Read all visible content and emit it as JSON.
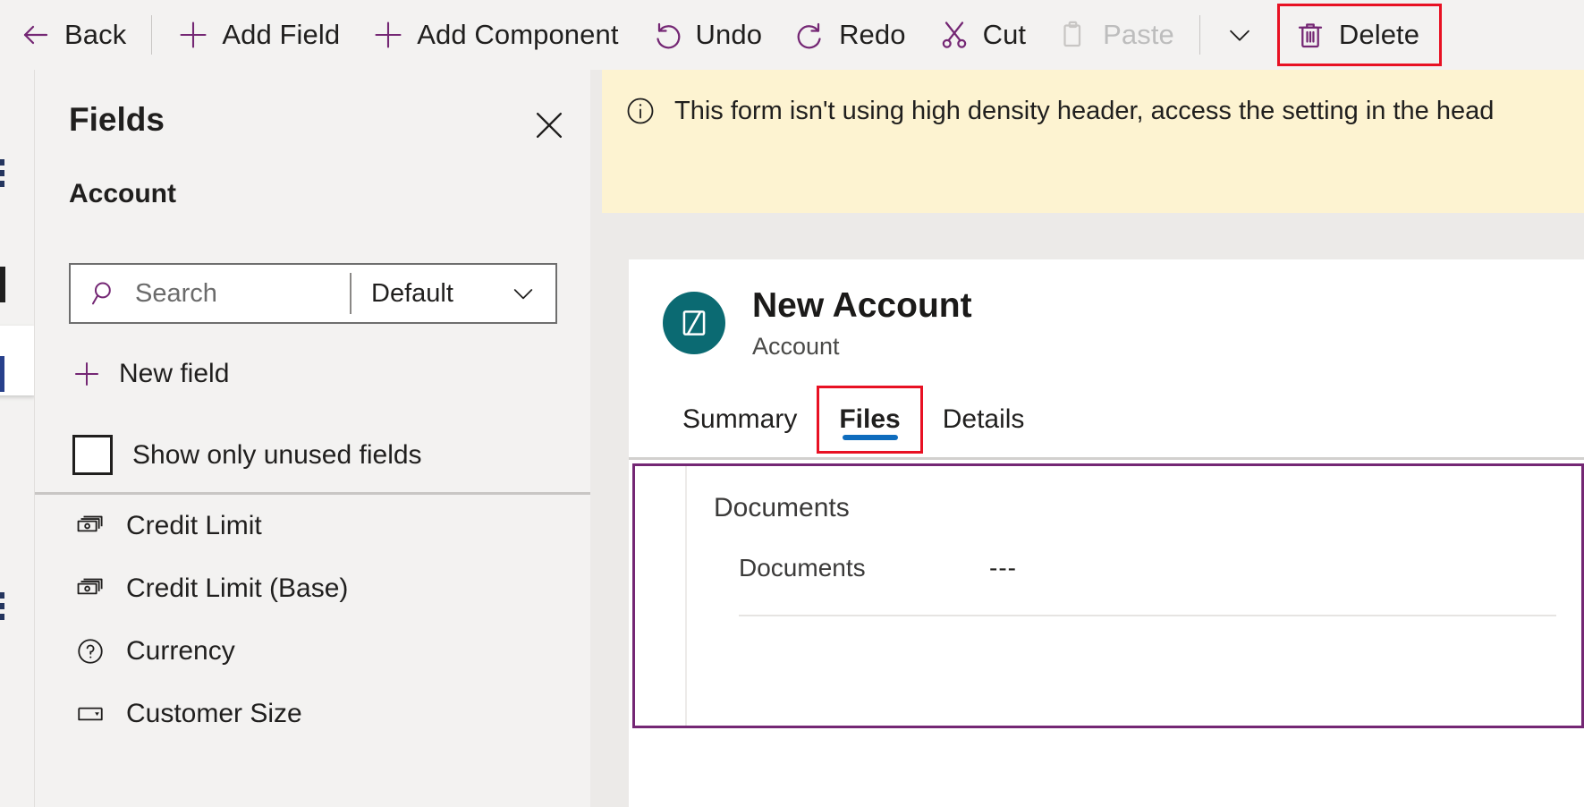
{
  "command_bar": {
    "items": [
      {
        "id": "back",
        "label": "Back",
        "icon": "arrow-left-icon",
        "disabled": false
      },
      {
        "id": "add-field",
        "label": "Add Field",
        "icon": "plus-icon",
        "disabled": false
      },
      {
        "id": "add-component",
        "label": "Add Component",
        "icon": "plus-icon",
        "disabled": false
      },
      {
        "id": "undo",
        "label": "Undo",
        "icon": "undo-icon",
        "disabled": false
      },
      {
        "id": "redo",
        "label": "Redo",
        "icon": "redo-icon",
        "disabled": false
      },
      {
        "id": "cut",
        "label": "Cut",
        "icon": "scissors-icon",
        "disabled": false
      },
      {
        "id": "paste",
        "label": "Paste",
        "icon": "clipboard-icon",
        "disabled": true
      },
      {
        "id": "delete",
        "label": "Delete",
        "icon": "trash-icon",
        "disabled": false
      }
    ],
    "overflow_icon": "chevron-down-icon",
    "highlight_color": "#e81123",
    "accent_color": "#742774"
  },
  "fields_panel": {
    "title": "Fields",
    "close_icon": "close-icon",
    "entity_tab": "Account",
    "entity_tab_accent": "#742774",
    "search": {
      "placeholder": "Search",
      "value": "",
      "icon": "search-icon"
    },
    "filter": {
      "selected": "Default",
      "chevron_icon": "chevron-down-icon"
    },
    "new_field": {
      "label": "New field",
      "icon": "plus-icon"
    },
    "unused_fields": {
      "label": "Show only unused fields",
      "checked": false
    },
    "scroll_up_icon": "caret-up-icon",
    "list": [
      {
        "label": "Credit Limit",
        "icon": "currency-icon"
      },
      {
        "label": "Credit Limit (Base)",
        "icon": "currency-icon"
      },
      {
        "label": "Currency",
        "icon": "lookup-icon"
      },
      {
        "label": "Customer Size",
        "icon": "choice-icon"
      }
    ]
  },
  "notification": {
    "icon": "info-icon",
    "text": "This form isn't using high density header, access the setting in the head",
    "background": "#fdf3d1"
  },
  "form_preview": {
    "record_title": "New Account",
    "record_subtitle": "Account",
    "avatar_icon": "account-entity-icon",
    "avatar_color": "#0b6a72",
    "tabs": [
      {
        "label": "Summary",
        "active": false,
        "highlighted": false
      },
      {
        "label": "Files",
        "active": true,
        "highlighted": true
      },
      {
        "label": "Details",
        "active": false,
        "highlighted": false
      }
    ],
    "active_tab_underline_color": "#0f6cbd",
    "selected_section_border": "#742774",
    "section": {
      "header": "Documents",
      "field_label": "Documents",
      "field_value": "---"
    }
  }
}
